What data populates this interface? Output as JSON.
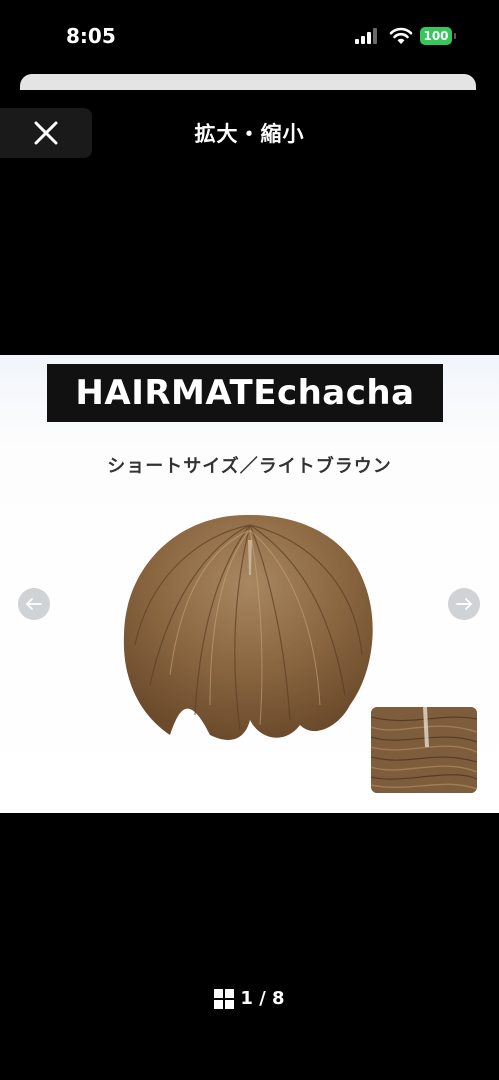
{
  "status_bar": {
    "time": "8:05",
    "battery": "100",
    "battery_color": "#35c759"
  },
  "header": {
    "title": "拡大・縮小",
    "close_icon": "close-icon"
  },
  "image": {
    "brand": "HAIRMATEchacha",
    "caption": "ショートサイズ／ライトブラウン",
    "prev_icon": "arrow-left-icon",
    "next_icon": "arrow-right-icon"
  },
  "pager": {
    "icon": "grid-icon",
    "text": "1 / 8"
  }
}
